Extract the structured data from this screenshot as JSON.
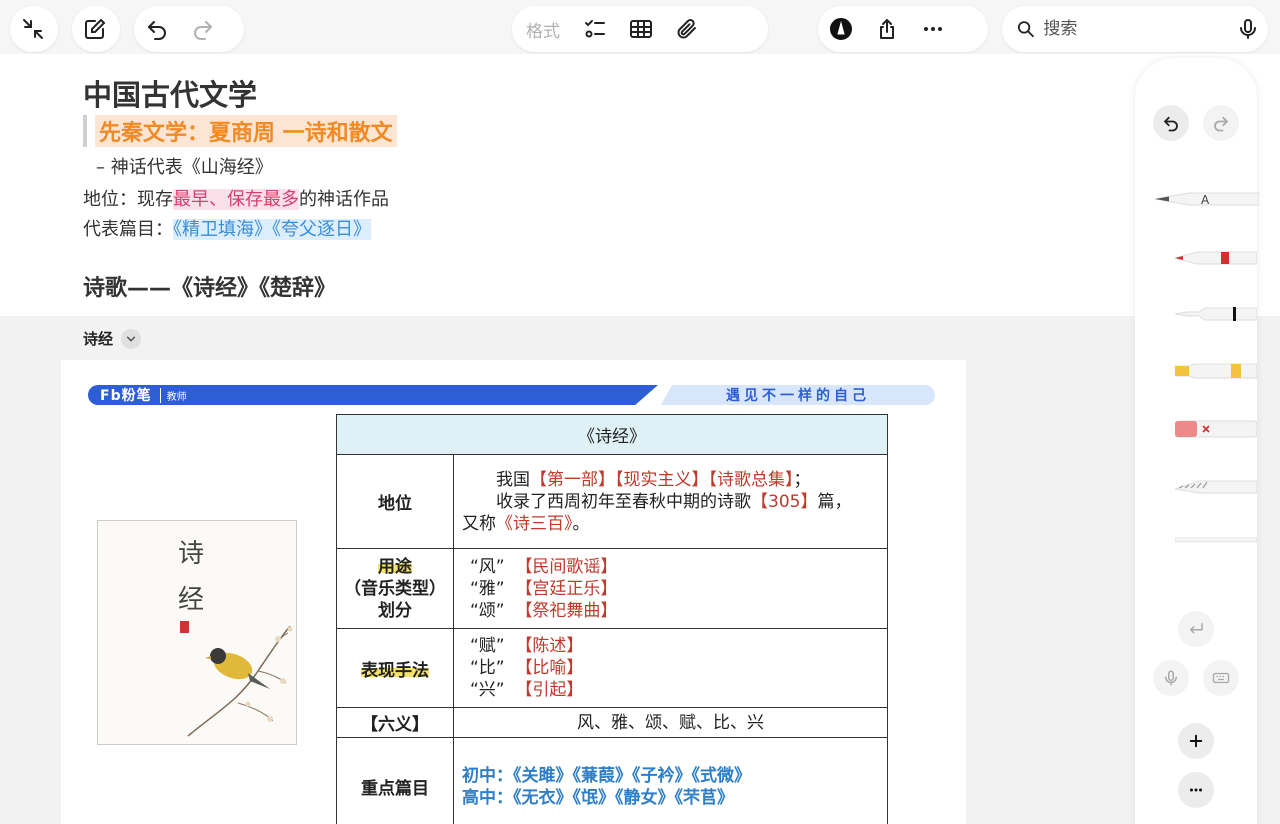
{
  "toolbar": {
    "format_label": "格式",
    "search_placeholder": "搜索"
  },
  "note": {
    "title": "中国古代文学",
    "section_heading": "先秦文学：夏商周 一诗和散文",
    "bullet": "–  神话代表《山海经》",
    "position_prefix": "地位：现存",
    "position_highlight": "最早、保存最多",
    "position_suffix": "的神话作品",
    "works_prefix": "代表篇目：",
    "works_highlight": "《精卫填海》《夸父逐日》",
    "poetry_heading": "诗歌——《诗经》《楚辞》",
    "attachment_label": "诗经"
  },
  "sheet": {
    "brand_logo": "Fb粉笔",
    "brand_sub": "教师",
    "slogan": "遇见不一样的自己",
    "cover_title": "诗经",
    "table_title": "《诗经》",
    "rows": {
      "status_label": "地位",
      "status_l1_a": "我国",
      "status_l1_b": "【第一部】",
      "status_l1_c": "【现实主义】",
      "status_l1_d": "【诗歌总集】",
      "status_l1_e": "；",
      "status_l2_a": "收录了西周初年至春秋中期的诗歌",
      "status_l2_b": "【305】",
      "status_l2_c": "篇，",
      "status_l3_a": "又称",
      "status_l3_b": "《诗三百》",
      "status_l3_c": "。",
      "use_label_1": "用途",
      "use_label_2": "（音乐类型）",
      "use_label_3": "划分",
      "feng": "“风”",
      "feng_v": "【民间歌谣】",
      "ya": "“雅”",
      "ya_v": "【宫廷正乐】",
      "song": "“颂”",
      "song_v": "【祭祀舞曲】",
      "tech_label": "表现手法",
      "fu": "“赋”",
      "fu_v": "【陈述】",
      "bi": "“比”",
      "bi_v": "【比喻】",
      "xing": "“兴”",
      "xing_v": "【引起】",
      "six_label": "【六义】",
      "six_value": "风、雅、颂、赋、比、兴",
      "key_label": "重点篇目",
      "key_junior": "初中：《关雎》《蒹葭》《子衿》《式微》",
      "key_senior": "高中：《无衣》《氓》《静女》《芣苢》"
    }
  },
  "colors": {
    "accent_orange": "#f08a24",
    "highlight_pink": "#d6406e",
    "highlight_blue": "#3a8ed8",
    "brand_blue": "#2e5ed6",
    "table_red": "#c0392b"
  }
}
